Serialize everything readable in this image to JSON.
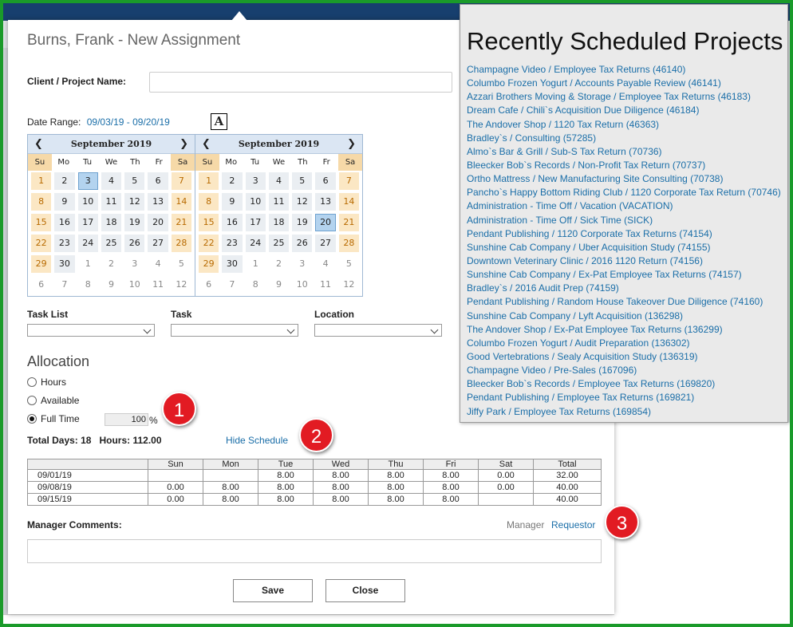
{
  "dialog": {
    "title": "Burns, Frank - New Assignment",
    "client_label": "Client / Project Name:",
    "client_value": "",
    "date_range_label": "Date Range:",
    "date_range_value": "09/03/19 - 09/20/19",
    "a_icon": "A"
  },
  "calendar_left": {
    "month": "September 2019",
    "dow": [
      "Su",
      "Mo",
      "Tu",
      "We",
      "Th",
      "Fr",
      "Sa"
    ],
    "days": [
      "1",
      "2",
      "3",
      "4",
      "5",
      "6",
      "7",
      "8",
      "9",
      "10",
      "11",
      "12",
      "13",
      "14",
      "15",
      "16",
      "17",
      "18",
      "19",
      "20",
      "21",
      "22",
      "23",
      "24",
      "25",
      "26",
      "27",
      "28",
      "29",
      "30",
      "1",
      "2",
      "3",
      "4",
      "5",
      "6",
      "7",
      "8",
      "9",
      "10",
      "11",
      "12"
    ],
    "selected": "3"
  },
  "calendar_right": {
    "month": "September 2019",
    "dow": [
      "Su",
      "Mo",
      "Tu",
      "We",
      "Th",
      "Fr",
      "Sa"
    ],
    "days": [
      "1",
      "2",
      "3",
      "4",
      "5",
      "6",
      "7",
      "8",
      "9",
      "10",
      "11",
      "12",
      "13",
      "14",
      "15",
      "16",
      "17",
      "18",
      "19",
      "20",
      "21",
      "22",
      "23",
      "24",
      "25",
      "26",
      "27",
      "28",
      "29",
      "30",
      "1",
      "2",
      "3",
      "4",
      "5",
      "6",
      "7",
      "8",
      "9",
      "10",
      "11",
      "12"
    ],
    "selected": "20"
  },
  "fields": {
    "task_list": "Task List",
    "task": "Task",
    "location": "Location"
  },
  "allocation": {
    "title": "Allocation",
    "options": [
      "Hours",
      "Available",
      "Full Time"
    ],
    "selected": "Full Time",
    "percent": "100",
    "percent_sign": "%",
    "totals": "Total Days: 18   Hours: 112.00",
    "hide_schedule": "Hide Schedule"
  },
  "schedule": {
    "headers": [
      "",
      "Sun",
      "Mon",
      "Tue",
      "Wed",
      "Thu",
      "Fri",
      "Sat",
      "Total"
    ],
    "rows": [
      [
        "09/01/19",
        "",
        "",
        "8.00",
        "8.00",
        "8.00",
        "8.00",
        "0.00",
        "32.00"
      ],
      [
        "09/08/19",
        "0.00",
        "8.00",
        "8.00",
        "8.00",
        "8.00",
        "8.00",
        "0.00",
        "40.00"
      ],
      [
        "09/15/19",
        "0.00",
        "8.00",
        "8.00",
        "8.00",
        "8.00",
        "8.00",
        "",
        "40.00"
      ]
    ]
  },
  "comments": {
    "label": "Manager Comments:",
    "tab_manager": "Manager",
    "tab_requestor": "Requestor"
  },
  "buttons": {
    "save": "Save",
    "close": "Close"
  },
  "badges": [
    "1",
    "2",
    "3"
  ],
  "recent": {
    "title": "Recently Scheduled Projects",
    "items": [
      "Champagne Video / Employee Tax Returns (46140)",
      "Columbo Frozen Yogurt / Accounts Payable Review (46141)",
      "Azzari Brothers Moving & Storage / Employee Tax Returns (46183)",
      "Dream Cafe / Chili`s Acquisition Due Diligence (46184)",
      "The Andover Shop / 1120 Tax Return (46363)",
      "Bradley`s / Consulting (57285)",
      "Almo`s Bar & Grill / Sub-S Tax Return (70736)",
      "Bleecker Bob`s Records / Non-Profit Tax Return (70737)",
      "Ortho Mattress / New Manufacturing Site Consulting (70738)",
      "Pancho`s Happy Bottom Riding Club / 1120 Corporate Tax Return (70746)",
      "Administration - Time Off / Vacation (VACATION)",
      "Administration - Time Off / Sick Time (SICK)",
      "Pendant Publishing / 1120 Corporate Tax Returns (74154)",
      "Sunshine Cab Company / Uber Acquisition Study (74155)",
      "Downtown Veterinary Clinic / 2016 1120 Return (74156)",
      "Sunshine Cab Company / Ex-Pat Employee Tax Returns (74157)",
      "Bradley`s / 2016 Audit Prep (74159)",
      "Pendant Publishing / Random House Takeover Due Diligence (74160)",
      "Sunshine Cab Company / Lyft Acquisition (136298)",
      "The Andover Shop / Ex-Pat Employee Tax Returns (136299)",
      "Columbo Frozen Yogurt / Audit Preparation (136302)",
      "Good Vertebrations / Sealy Acquisition Study (136319)",
      "Champagne Video / Pre-Sales (167096)",
      "Bleecker Bob`s Records / Employee Tax Returns (169820)",
      "Pendant Publishing / Employee Tax Returns (169821)",
      "Jiffy Park / Employee Tax Returns (169854)"
    ]
  },
  "colors": {
    "frame": "#1a9a2a",
    "link": "#1a6ea8",
    "badge": "#e21b23",
    "weekend": "#fbe7c4"
  }
}
